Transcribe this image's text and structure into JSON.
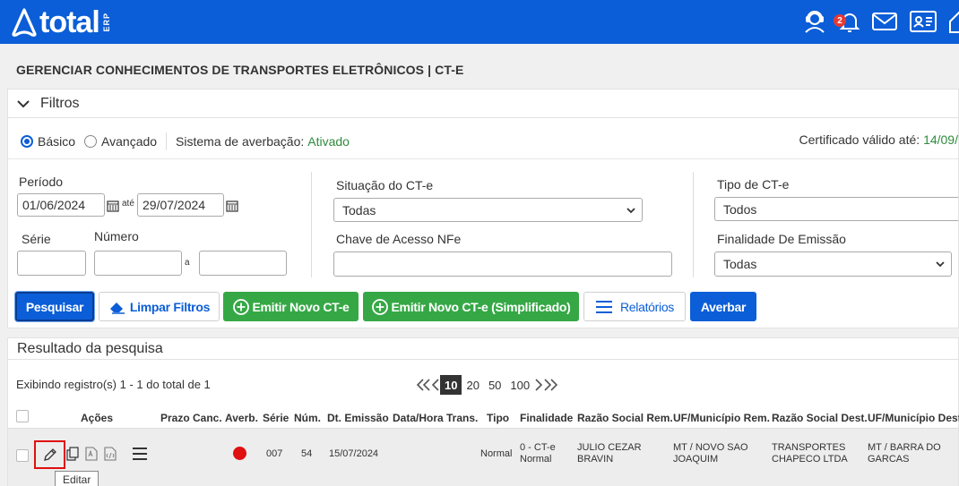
{
  "header": {
    "logo_text": "total",
    "logo_sub": "ERP",
    "notif_count": "2",
    "icons": [
      "support-icon",
      "bell-icon",
      "mail-icon",
      "profile-card-icon",
      "home-icon"
    ]
  },
  "page_title": "GERENCIAR CONHECIMENTOS DE TRANSPORTES ELETRÔNICOS | CT-E",
  "filters": {
    "title": "Filtros",
    "mode_basic": "Básico",
    "mode_advanced": "Avançado",
    "averbacao_label": "Sistema de averbação:",
    "averbacao_value": "Ativado",
    "cert_label": "Certificado válido até:",
    "cert_value": "14/09/",
    "periodo_label": "Período",
    "date_from": "01/06/2024",
    "ate": "até",
    "date_to": "29/07/2024",
    "serie_label": "Série",
    "numero_label": "Número",
    "a": "a",
    "situacao_label": "Situação do CT-e",
    "situacao_value": "Todas",
    "chave_label": "Chave de Acesso NFe",
    "tipo_label": "Tipo de CT-e",
    "tipo_value": "Todos",
    "finalidade_label": "Finalidade De Emissão",
    "finalidade_value": "Todas"
  },
  "buttons": {
    "pesquisar": "Pesquisar",
    "limpar": "Limpar Filtros",
    "emitir": "Emitir Novo CT-e",
    "emitir_simpl": "Emitir Novo CT-e (Simplificado)",
    "relatorios": "Relatórios",
    "averbar": "Averbar"
  },
  "results": {
    "title": "Resultado da pesquisa",
    "info": "Exibindo registro(s) 1 - 1 do total de 1",
    "page_sizes": [
      "10",
      "20",
      "50",
      "100"
    ],
    "page_size_selected": "10",
    "columns": [
      "Ações",
      "Prazo Canc.",
      "Averb.",
      "Série",
      "Núm.",
      "Dt. Emissão",
      "Data/Hora Trans.",
      "Tipo",
      "Finalidade",
      "Razão Social Rem.",
      "UF/Município Rem.",
      "Razão Social Dest.",
      "UF/Município Dest."
    ],
    "row": {
      "serie": "007",
      "num": "54",
      "emissao": "15/07/2024",
      "tipo": "Normal",
      "finalidade_1": "0 - CT-e",
      "finalidade_2": "Normal",
      "rem_1": "JULIO CEZAR",
      "rem_2": "BRAVIN",
      "ufrem_1": "MT / NOVO SAO",
      "ufrem_2": "JOAQUIM",
      "dest_1": "TRANSPORTES",
      "dest_2": "CHAPECO LTDA",
      "ufdest_1": "MT / BARRA DO",
      "ufdest_2": "GARCAS",
      "averb_color": "#e01010"
    },
    "tooltip": "Editar"
  }
}
